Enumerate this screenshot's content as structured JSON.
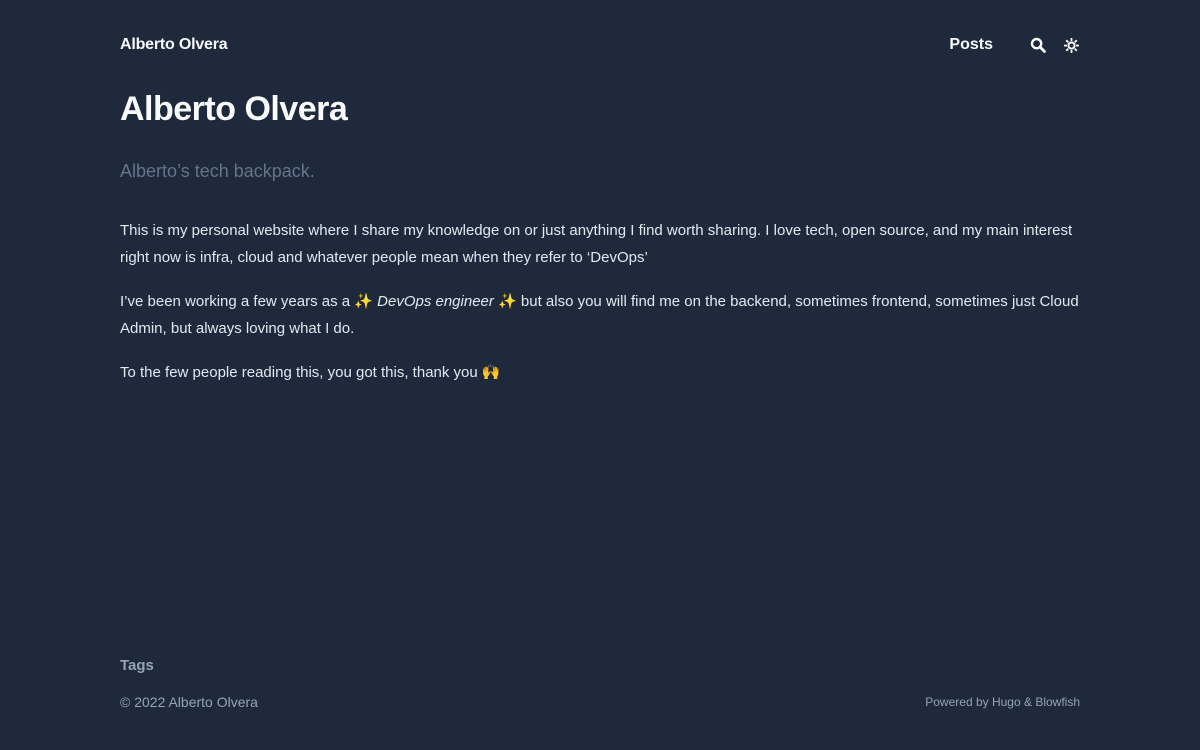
{
  "header": {
    "site_name": "Alberto Olvera",
    "nav": {
      "posts_label": "Posts"
    },
    "icons": {
      "search": "search-icon",
      "theme": "sun-icon"
    }
  },
  "main": {
    "title": "Alberto Olvera",
    "tagline": "Alberto’s tech backpack.",
    "paragraphs": {
      "p1": "This is my personal website where I share my knowledge on or just anything I find worth sharing. I love tech, open source, and my main interest right now is infra, cloud and whatever people mean when they refer to ‘DevOps’",
      "p2_before": "I’ve been working a few years as a ✨ ",
      "p2_emphasis": "DevOps engineer",
      "p2_after": " ✨ but also you will find me on the backend, sometimes frontend, sometimes just Cloud Admin, but always loving what I do.",
      "p3": "To the few people reading this, you got this, thank you 🙌"
    }
  },
  "footer": {
    "tags_label": "Tags",
    "copyright": "© 2022 Alberto Olvera",
    "powered_by": "Powered by Hugo & Blowfish"
  },
  "colors": {
    "background": "#1e293b",
    "text": "#e2e8f0",
    "heading": "#f8fafc",
    "muted": "#64748b",
    "footer": "#94a3b8"
  }
}
